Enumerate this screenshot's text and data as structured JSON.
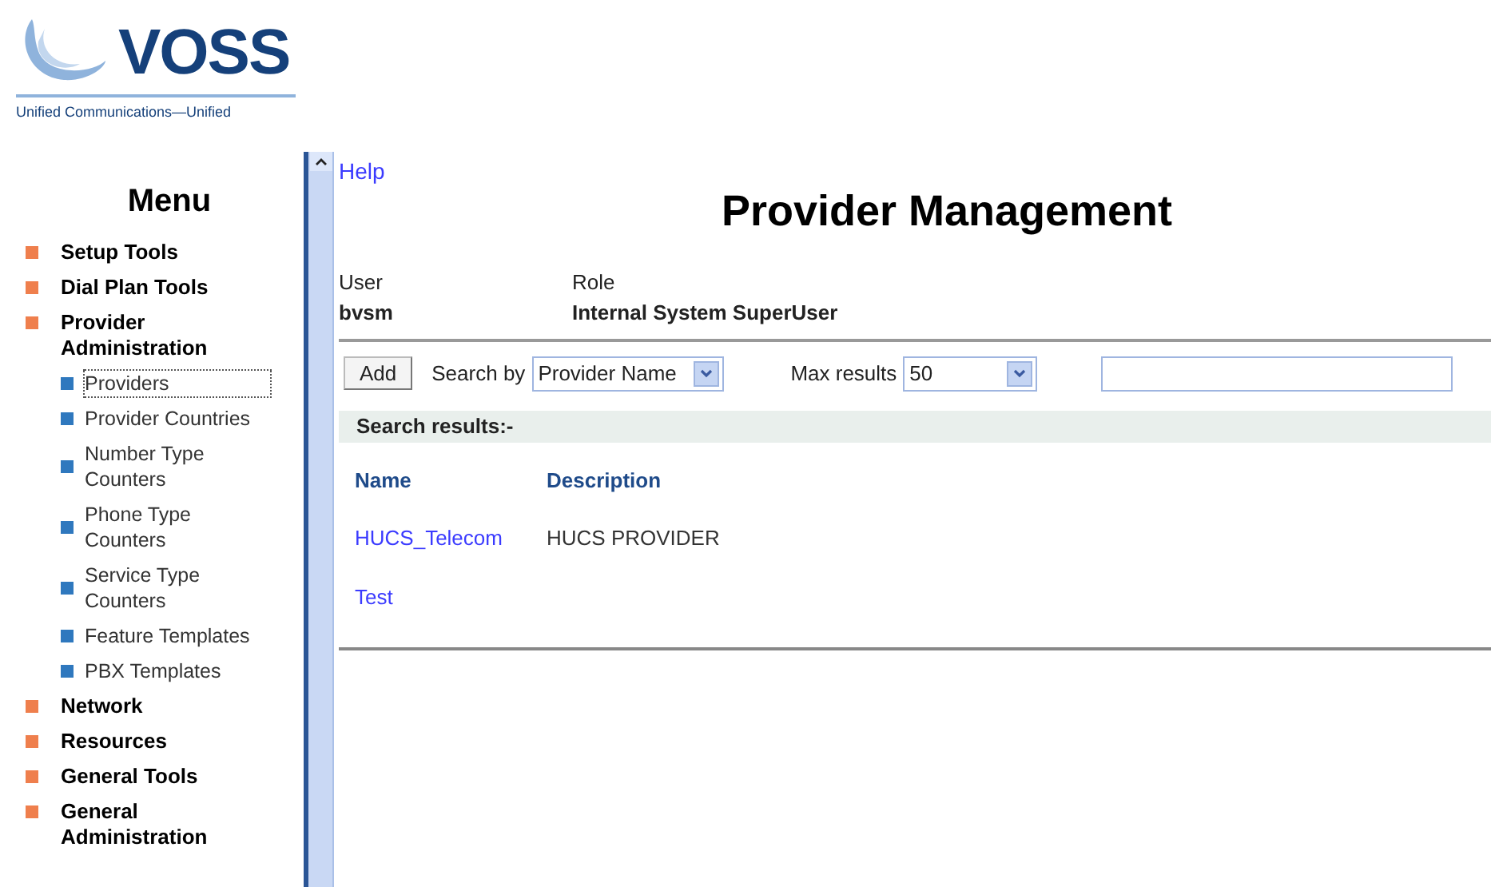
{
  "logo": {
    "name": "VOSS",
    "tagline": "Unified Communications—Unified"
  },
  "menu": {
    "title": "Menu",
    "items": [
      {
        "label": "Setup Tools"
      },
      {
        "label": "Dial Plan Tools"
      },
      {
        "label": "Provider Administration",
        "children": [
          {
            "label": "Providers",
            "selected": true
          },
          {
            "label": "Provider Countries",
            "selected": false
          },
          {
            "label": "Number Type Counters",
            "selected": false
          },
          {
            "label": "Phone Type Counters",
            "selected": false
          },
          {
            "label": "Service Type Counters",
            "selected": false
          },
          {
            "label": "Feature Templates",
            "selected": false
          },
          {
            "label": "PBX Templates",
            "selected": false
          }
        ]
      },
      {
        "label": "Network"
      },
      {
        "label": "Resources"
      },
      {
        "label": "General Tools"
      },
      {
        "label": "General Administration"
      }
    ]
  },
  "help": "Help",
  "page_title": "Provider Management",
  "user": {
    "label": "User",
    "value": "bvsm"
  },
  "role": {
    "label": "Role",
    "value": "Internal System SuperUser"
  },
  "toolbar": {
    "add": "Add",
    "search_by_label": "Search by",
    "search_by": "Provider Name",
    "max_results_label": "Max results",
    "max_results": "50"
  },
  "results": {
    "title": "Search results:-",
    "columns": [
      "Name",
      "Description"
    ],
    "rows": [
      {
        "name": "HUCS_Telecom",
        "description": "HUCS PROVIDER"
      },
      {
        "name": "Test"
      }
    ]
  }
}
